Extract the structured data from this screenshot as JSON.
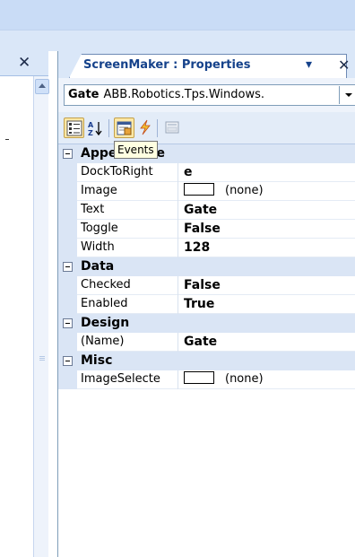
{
  "tool_window": {
    "title": "ScreenMaker : Properties",
    "pin_icon": "pin-dropdown-icon",
    "close_icon": "close-icon"
  },
  "left_pane": {
    "close_icon": "close-icon",
    "scroll_up_icon": "scroll-up-arrow-icon"
  },
  "object_selector": {
    "name": "Gate",
    "type": "ABB.Robotics.Tps.Windows."
  },
  "toolbar": {
    "categorized_icon": "categorized-icon",
    "alphabetical_icon": "alphabetical-sort-icon",
    "properties_icon": "properties-icon",
    "events_icon": "events-lightning-icon",
    "property_pages_icon": "property-pages-icon"
  },
  "tooltip": {
    "text": "Events"
  },
  "grid": {
    "categories": [
      {
        "name": "Appearance",
        "properties": [
          {
            "name": "DockToRight",
            "value": "e",
            "bold": true
          },
          {
            "name": "Image",
            "value": "(none)",
            "swatch": true
          },
          {
            "name": "Text",
            "value": "Gate",
            "bold": true
          },
          {
            "name": "Toggle",
            "value": "False",
            "bold": true
          },
          {
            "name": "Width",
            "value": "128",
            "bold": true
          }
        ]
      },
      {
        "name": "Data",
        "properties": [
          {
            "name": "Checked",
            "value": "False",
            "bold": true
          },
          {
            "name": "Enabled",
            "value": "True",
            "bold": true
          }
        ]
      },
      {
        "name": "Design",
        "properties": [
          {
            "name": "(Name)",
            "value": "Gate",
            "bold": true
          }
        ]
      },
      {
        "name": "Misc",
        "properties": [
          {
            "name": "ImageSelecte",
            "value": "(none)",
            "swatch": true
          }
        ]
      }
    ]
  },
  "colors": {
    "title_text": "#15428b",
    "pane_header": "#dae7f8",
    "category_band": "#dae5f5",
    "tooltip_bg": "#ffffe1",
    "selected_button": "#ffe8a6"
  }
}
